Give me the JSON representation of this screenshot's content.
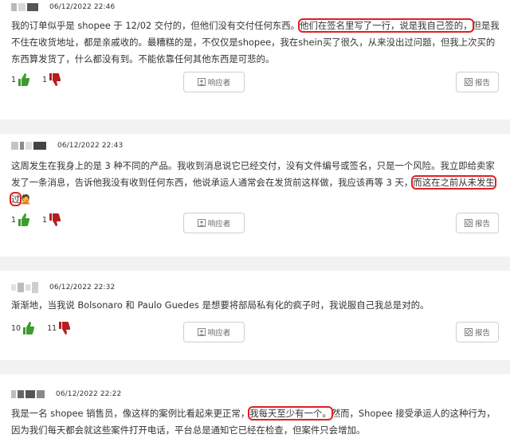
{
  "colors": {
    "like": "#3e9b2f",
    "dislike": "#b51e1e",
    "highlight": "#e02020",
    "divider": "#f2f2f2"
  },
  "labels": {
    "reply": "响应者",
    "report": "报告"
  },
  "icons": {
    "like": "thumbs-up-icon",
    "dislike": "thumbs-down-icon",
    "reply": "user-icon",
    "report": "block-icon"
  },
  "comments": [
    {
      "timestamp": "",
      "segments": [
        {
          "text": "我的订单似乎是 shopee 于 12/02 交付的，但他们没有交付任何东西。",
          "hl": false
        },
        {
          "text": "他们在签名里写了一行，说是我自己签的，",
          "hl": true
        },
        {
          "text": "但是我不住在收货地址，都是亲戚收的。最糟糕的是，不仅仅是shopee，我在shein买了很久，从来没出过问题，但我上次买的东西算发货了，什么都没有到。不能依靠任何其他东西是可悲的。",
          "hl": false
        }
      ],
      "likes": "1",
      "dislikes": "1"
    },
    {
      "timestamp": "06/12/2022 22:46",
      "segments": [],
      "likes": "",
      "dislikes": ""
    },
    {
      "timestamp": "06/12/2022 22:43",
      "segments": [
        {
          "text": "这周发生在我身上的是 3 种不同的产品。我收到消息说它已经交付，没有文件编号或签名，只是一个风险。我立即给卖家发了一条消息，告诉他我没有收到任何东西，他说承运人通常会在发货前这样做，我应该再等 3 天，",
          "hl": false
        },
        {
          "text": "而这在之前从未发生过",
          "hl": true
        },
        {
          "text": "🤦",
          "hl": false
        }
      ],
      "likes": "1",
      "dislikes": "1"
    },
    {
      "timestamp": "06/12/2022 22:32",
      "segments": [
        {
          "text": "渐渐地，当我说 Bolsonaro 和 Paulo Guedes 是想要将部局私有化的疯子时，我说服自己我总是对的。",
          "hl": false
        }
      ],
      "likes": "10",
      "dislikes": "11"
    },
    {
      "timestamp": "06/12/2022 22:22",
      "segments": [
        {
          "text": "我是一名 shopee 销售员，像这样的案例比看起来更正常，",
          "hl": false
        },
        {
          "text": "我每天至少有一个。",
          "hl": true
        },
        {
          "text": "然而，Shopee 接受承运人的这种行为，因为我们每天都会就这些案件打开电话，平台总是通知它已经在检查，但案件只会增加。",
          "hl": false
        }
      ],
      "likes": "",
      "dislikes": ""
    }
  ]
}
